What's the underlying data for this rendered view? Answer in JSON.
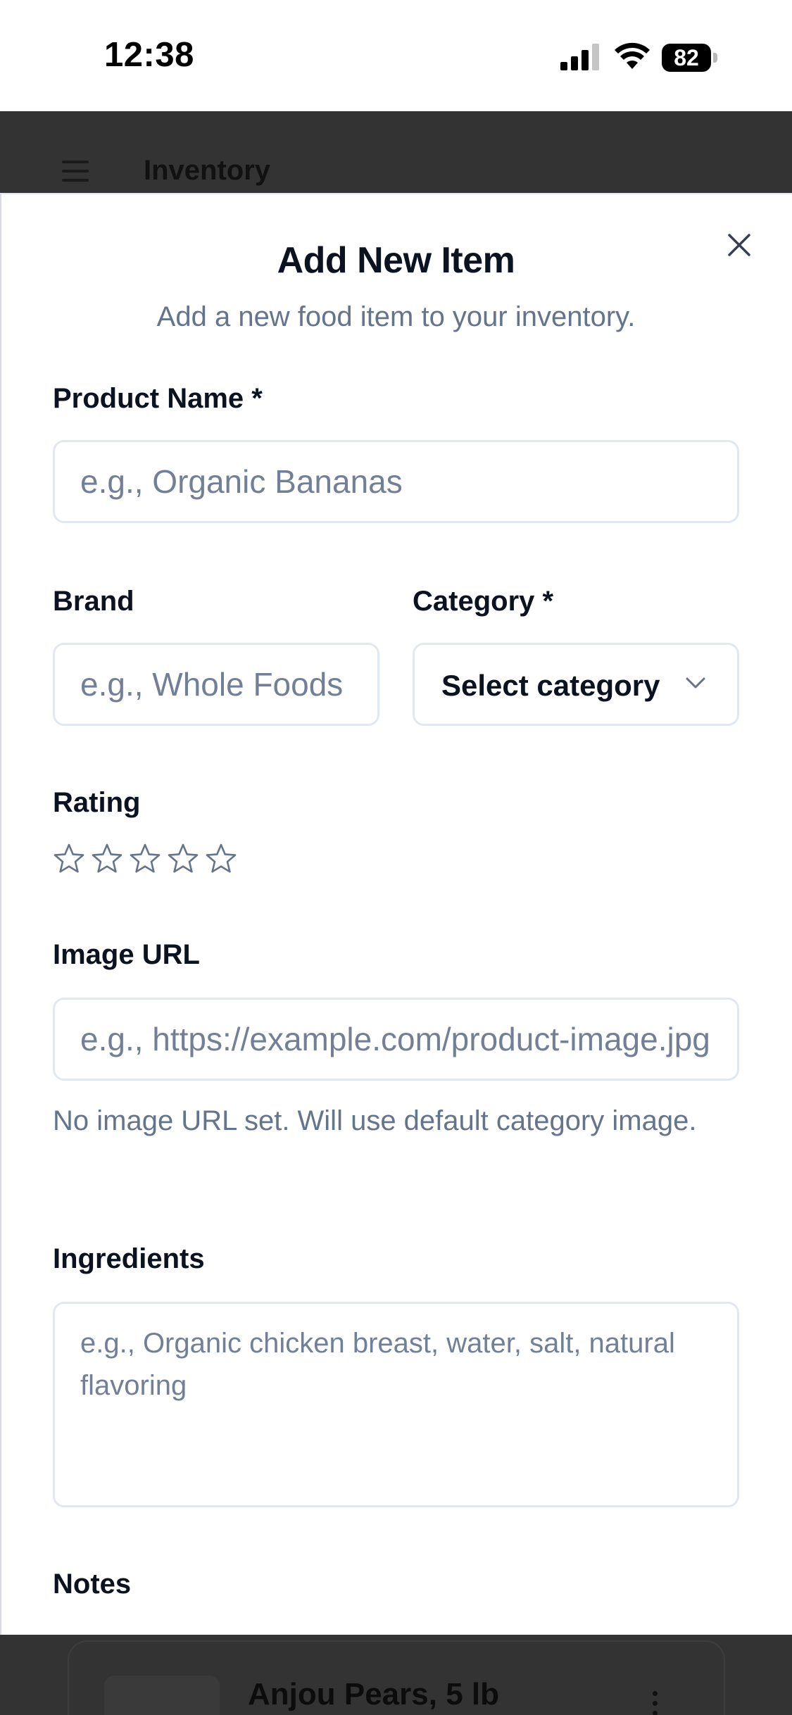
{
  "status_bar": {
    "time": "12:38",
    "battery": "82"
  },
  "app_header": {
    "title": "Inventory"
  },
  "modal": {
    "title": "Add New Item",
    "subtitle": "Add a new food item to your inventory.",
    "fields": {
      "product_name": {
        "label": "Product Name *",
        "placeholder": "e.g., Organic Bananas"
      },
      "brand": {
        "label": "Brand",
        "placeholder": "e.g., Whole Foods"
      },
      "category": {
        "label": "Category *",
        "value": "Select category"
      },
      "rating": {
        "label": "Rating",
        "stars_total": 5,
        "stars_filled": 0
      },
      "image_url": {
        "label": "Image URL",
        "placeholder": "e.g., https://example.com/product-image.jpg",
        "help": "No image URL set. Will use default category image."
      },
      "ingredients": {
        "label": "Ingredients",
        "placeholder": "e.g., Organic chicken breast, water, salt, natural flavoring"
      },
      "notes": {
        "label": "Notes"
      }
    }
  },
  "list_preview": {
    "item_title": "Anjou Pears, 5 lb"
  },
  "colors": {
    "header_bg": "#333333",
    "placeholder": "#718096",
    "muted_text": "#64748b",
    "border": "#e2e8f0",
    "heading": "#0b1220"
  }
}
